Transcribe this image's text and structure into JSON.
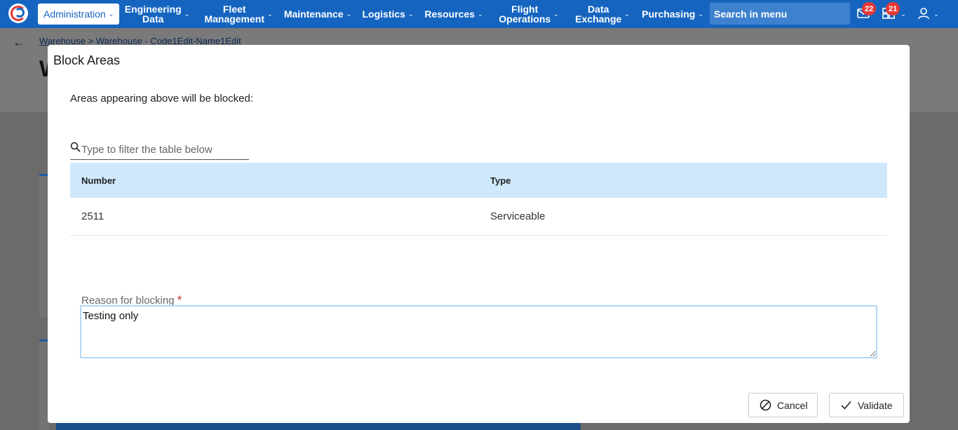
{
  "topnav": {
    "admin_label": "Administration",
    "items": [
      {
        "label_line1": "Engineering",
        "label_line2": "Data"
      },
      {
        "label_line1": "Fleet",
        "label_line2": "Management"
      },
      {
        "label_line1": "Maintenance",
        "label_line2": ""
      },
      {
        "label_line1": "Logistics",
        "label_line2": ""
      },
      {
        "label_line1": "Resources",
        "label_line2": ""
      },
      {
        "label_line1": "Flight",
        "label_line2": "Operations"
      },
      {
        "label_line1": "Data",
        "label_line2": "Exchange"
      },
      {
        "label_line1": "Purchasing",
        "label_line2": ""
      }
    ],
    "search_placeholder": "Search in menu",
    "mail_badge": "22",
    "tasks_badge": "21"
  },
  "page": {
    "breadcrumb_root": "Warehouse",
    "breadcrumb_sep": " > ",
    "breadcrumb_current": "Warehouse - Code1Edit-Name1Edit",
    "title_visible": "W"
  },
  "modal": {
    "title": "Block Areas",
    "description": "Areas appearing above will be blocked:",
    "filter_placeholder": "Type to filter the table below",
    "table": {
      "headers": [
        "Number",
        "Type"
      ],
      "rows": [
        [
          "2511",
          "Serviceable"
        ]
      ]
    },
    "reason_label": "Reason for blocking",
    "reason_required_mark": "*",
    "reason_value": "Testing only",
    "cancel_label": "Cancel",
    "validate_label": "Validate"
  },
  "colors": {
    "nav_blue": "#1565c0",
    "table_header": "#cfe8fc",
    "badge_red": "#e53935"
  }
}
